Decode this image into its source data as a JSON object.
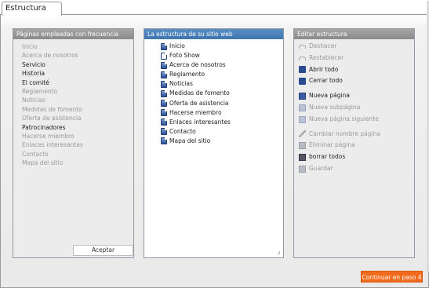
{
  "tab": {
    "label": "Estructura"
  },
  "pages_panel": {
    "title": "Páginas empleadas con frecuencia",
    "items": [
      {
        "label": "Inicio",
        "active": false
      },
      {
        "label": "Acerca de nosotros",
        "active": false
      },
      {
        "label": "Servicio",
        "active": true
      },
      {
        "label": "Historia",
        "active": true
      },
      {
        "label": "El comité",
        "active": true
      },
      {
        "label": "Reglamento",
        "active": false
      },
      {
        "label": "Noticias",
        "active": false
      },
      {
        "label": "Medidas de fomento",
        "active": false
      },
      {
        "label": "Oferta de asistencia",
        "active": false
      },
      {
        "label": "Patrocinadores",
        "active": true
      },
      {
        "label": "Hacerse miembro",
        "active": false
      },
      {
        "label": "Enlaces interesantes",
        "active": false
      },
      {
        "label": "Contacto",
        "active": false
      },
      {
        "label": "Mapa del sitio",
        "active": false
      }
    ],
    "accept_label": "Aceptar"
  },
  "tree_panel": {
    "title": "La estructura de su sitio web",
    "items": [
      {
        "label": "Inicio",
        "icon": "page-icon"
      },
      {
        "label": "Foto Show",
        "icon": "page-icon"
      },
      {
        "label": "Acerca de nosotros",
        "icon": "page-icon"
      },
      {
        "label": "Reglamento",
        "icon": "page-icon"
      },
      {
        "label": "Noticias",
        "icon": "page-icon"
      },
      {
        "label": "Medidas de fomento",
        "icon": "page-icon"
      },
      {
        "label": "Oferta de asistencia",
        "icon": "page-icon"
      },
      {
        "label": "Hacerse miembro",
        "icon": "page-icon"
      },
      {
        "label": "Enlaces interesantes",
        "icon": "page-icon"
      },
      {
        "label": "Contacto",
        "icon": "page-icon"
      },
      {
        "label": "Mapa del sitio",
        "icon": "page-icon"
      }
    ]
  },
  "editor_panel": {
    "title": "Editar estructura",
    "actions": [
      {
        "label": "Deshacer",
        "icon": "undo-icon",
        "enabled": false
      },
      {
        "label": "Restablecer",
        "icon": "redo-icon",
        "enabled": false
      },
      {
        "label": "Abrir todo",
        "icon": "folder-open-icon",
        "enabled": true
      },
      {
        "label": "Cerrar todo",
        "icon": "folder-closed-icon",
        "enabled": true
      },
      {
        "label": "Nueva página",
        "icon": "new-page-icon",
        "enabled": true
      },
      {
        "label": "Nueva subpágina",
        "icon": "new-subpage-icon",
        "enabled": false
      },
      {
        "label": "Nueva página siguiente",
        "icon": "new-next-page-icon",
        "enabled": false
      },
      {
        "label": "Cambiar nombre página",
        "icon": "rename-icon",
        "enabled": false
      },
      {
        "label": "Eliminar página",
        "icon": "delete-icon",
        "enabled": false
      },
      {
        "label": "borrar todos",
        "icon": "delete-all-icon",
        "enabled": true
      },
      {
        "label": "Guardar",
        "icon": "save-icon",
        "enabled": false
      }
    ]
  },
  "footer": {
    "continue_label": "Continuar en paso 4"
  },
  "colors": {
    "accent": "#f26b1d",
    "tree_header": "#4a80b8",
    "panel_header": "#999999"
  }
}
